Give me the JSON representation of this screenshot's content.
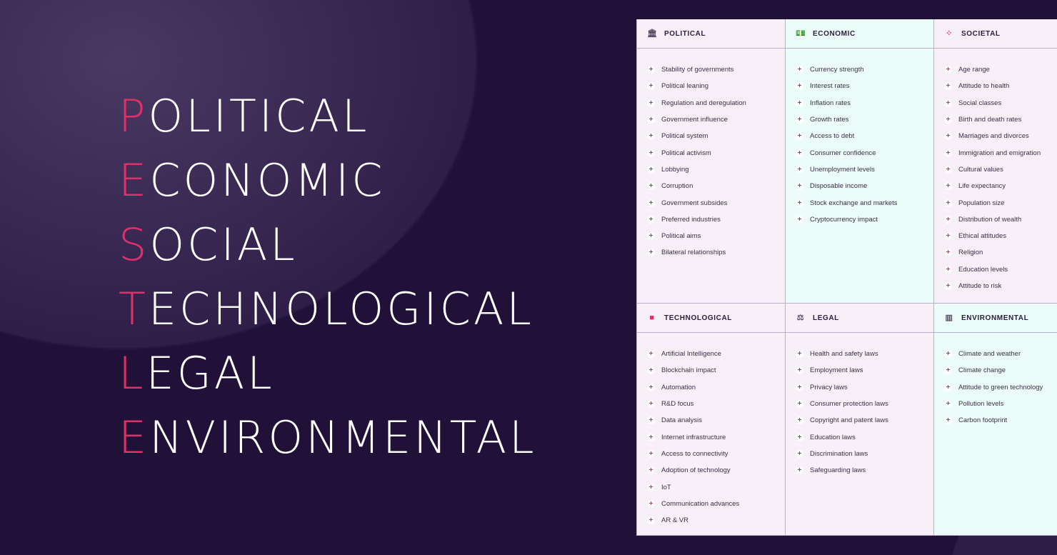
{
  "headline": [
    {
      "first": "P",
      "rest": "OLITICAL"
    },
    {
      "first": "E",
      "rest": "CONOMIC"
    },
    {
      "first": "S",
      "rest": "OCIAL"
    },
    {
      "first": "T",
      "rest": "ECHNOLOGICAL"
    },
    {
      "first": "L",
      "rest": "EGAL"
    },
    {
      "first": "E",
      "rest": "NVIRONMENTAL"
    }
  ],
  "colors": {
    "accent": "#e0306a",
    "background": "#211139"
  },
  "sections": [
    {
      "title": "POLITICAL",
      "icon": "government-building-icon",
      "items": [
        "Stability of governments",
        "Political leaning",
        "Regulation and deregulation",
        "Government influence",
        "Political system",
        "Political activism",
        "Lobbying",
        "Corruption",
        "Government subsides",
        "Preferred industries",
        "Political aims",
        "Bilateral relationships"
      ]
    },
    {
      "title": "ECONOMIC",
      "icon": "money-icon",
      "items": [
        "Currency strength",
        "Interest rates",
        "Inflation rates",
        "Growth rates",
        "Access to debt",
        "Consumer confidence",
        "Unemployment levels",
        "Disposable income",
        "Stock exchange and markets",
        "Cryptocurrency impact"
      ]
    },
    {
      "title": "SOCIETAL",
      "icon": "people-icon",
      "items": [
        "Age range",
        "Attitude to health",
        "Social classes",
        "Birth and death rates",
        "Marriages and divorces",
        "Immigration and emigration",
        "Cultural values",
        "Life expectancy",
        "Population size",
        "Distribution of wealth",
        "Ethical attitudes",
        "Religion",
        "Education levels",
        "Attitude to risk"
      ]
    },
    {
      "title": "TECHNOLOGICAL",
      "icon": "chip-icon",
      "items": [
        "Artificial Intelligence",
        "Blockchain impact",
        "Automation",
        "R&D focus",
        "Data analysis",
        "Internet infrastructure",
        "Access to connectivity",
        "Adoption of technology",
        "IoT",
        "Communication advances",
        "AR & VR"
      ]
    },
    {
      "title": "LEGAL",
      "icon": "scales-icon",
      "items": [
        "Health and safety laws",
        "Employment laws",
        "Privacy laws",
        "Consumer protection laws",
        "Copyright and patent laws",
        "Education laws",
        "Discrimination laws",
        "Safeguarding laws"
      ]
    },
    {
      "title": "ENVIRONMENTAL",
      "icon": "factory-icon",
      "items": [
        "Climate and weather",
        "Climate change",
        "Attitude to green technology",
        "Pollution levels",
        "Carbon footprint"
      ]
    }
  ]
}
